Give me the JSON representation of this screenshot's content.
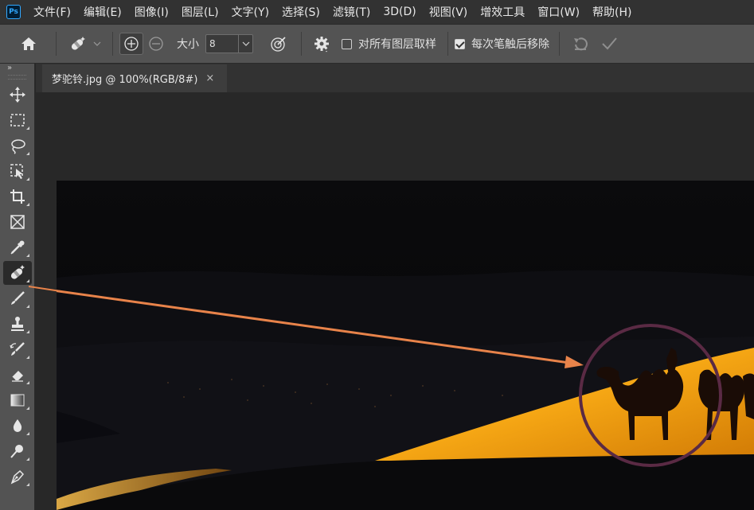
{
  "app": {
    "logo_text": "Ps"
  },
  "menu": {
    "items": [
      "文件(F)",
      "编辑(E)",
      "图像(I)",
      "图层(L)",
      "文字(Y)",
      "选择(S)",
      "滤镜(T)",
      "3D(D)",
      "视图(V)",
      "增效工具",
      "窗口(W)",
      "帮助(H)"
    ]
  },
  "options": {
    "size_label": "大小",
    "size_value": "8",
    "sample_all_layers_label": "对所有图层取样",
    "sample_all_layers_checked": false,
    "remove_after_stroke_label": "每次笔触后移除",
    "remove_after_stroke_checked": true
  },
  "toolbar": {
    "collapse_label": "»",
    "tools": [
      {
        "icon": "move-icon"
      },
      {
        "icon": "marquee-icon"
      },
      {
        "icon": "lasso-icon"
      },
      {
        "icon": "object-selection-icon"
      },
      {
        "icon": "crop-icon"
      },
      {
        "icon": "frame-icon"
      },
      {
        "icon": "eyedropper-icon"
      },
      {
        "icon": "remove-tool-icon",
        "active": true
      },
      {
        "icon": "brush-icon"
      },
      {
        "icon": "clone-stamp-icon"
      },
      {
        "icon": "history-brush-icon"
      },
      {
        "icon": "eraser-icon"
      },
      {
        "icon": "gradient-icon"
      },
      {
        "icon": "blur-icon"
      },
      {
        "icon": "dodge-icon"
      },
      {
        "icon": "pen-icon"
      }
    ]
  },
  "document": {
    "tab_title": "梦驼铃.jpg @ 100%(RGB/8#)",
    "close_glyph": "×"
  },
  "colors": {
    "annotation_arrow": "#e8834a",
    "annotation_circle": "#5a2a44",
    "sand": "#f5a614"
  }
}
